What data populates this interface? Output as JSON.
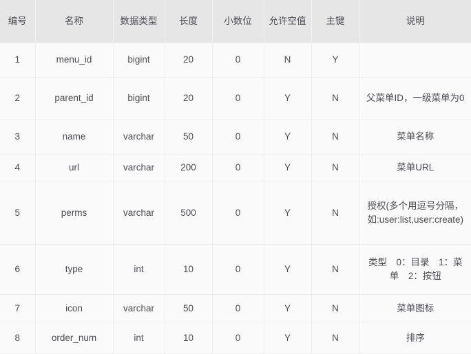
{
  "table": {
    "columns": [
      {
        "key": "no",
        "label": "编号"
      },
      {
        "key": "name",
        "label": "名称"
      },
      {
        "key": "type",
        "label": "数据类型"
      },
      {
        "key": "length",
        "label": "长度"
      },
      {
        "key": "decimal",
        "label": "小数位"
      },
      {
        "key": "nullable",
        "label": "允许空值"
      },
      {
        "key": "pk",
        "label": "主键"
      },
      {
        "key": "comment",
        "label": "说明"
      }
    ],
    "rows": [
      {
        "no": "1",
        "name": "menu_id",
        "type": "bigint",
        "length": "20",
        "decimal": "0",
        "nullable": "N",
        "pk": "Y",
        "comment": ""
      },
      {
        "no": "2",
        "name": "parent_id",
        "type": "bigint",
        "length": "20",
        "decimal": "0",
        "nullable": "Y",
        "pk": "N",
        "comment": "父菜单ID，一级菜单为0"
      },
      {
        "no": "3",
        "name": "name",
        "type": "varchar",
        "length": "50",
        "decimal": "0",
        "nullable": "Y",
        "pk": "N",
        "comment": "菜单名称"
      },
      {
        "no": "4",
        "name": "url",
        "type": "varchar",
        "length": "200",
        "decimal": "0",
        "nullable": "Y",
        "pk": "N",
        "comment": "菜单URL"
      },
      {
        "no": "5",
        "name": "perms",
        "type": "varchar",
        "length": "500",
        "decimal": "0",
        "nullable": "Y",
        "pk": "N",
        "comment": "授权(多个用逗号分隔，如:user:list,user:create)"
      },
      {
        "no": "6",
        "name": "type",
        "type": "int",
        "length": "10",
        "decimal": "0",
        "nullable": "Y",
        "pk": "N",
        "comment": "类型　0：目录　1：菜单　2：按钮"
      },
      {
        "no": "7",
        "name": "icon",
        "type": "varchar",
        "length": "50",
        "decimal": "0",
        "nullable": "Y",
        "pk": "N",
        "comment": "菜单图标"
      },
      {
        "no": "8",
        "name": "order_num",
        "type": "int",
        "length": "10",
        "decimal": "0",
        "nullable": "Y",
        "pk": "N",
        "comment": "排序"
      }
    ]
  },
  "colors": {
    "header_background": "#e6e6e6",
    "row_background": "#fafafa",
    "border": "#eeeeee",
    "text": "#4c4c56"
  }
}
